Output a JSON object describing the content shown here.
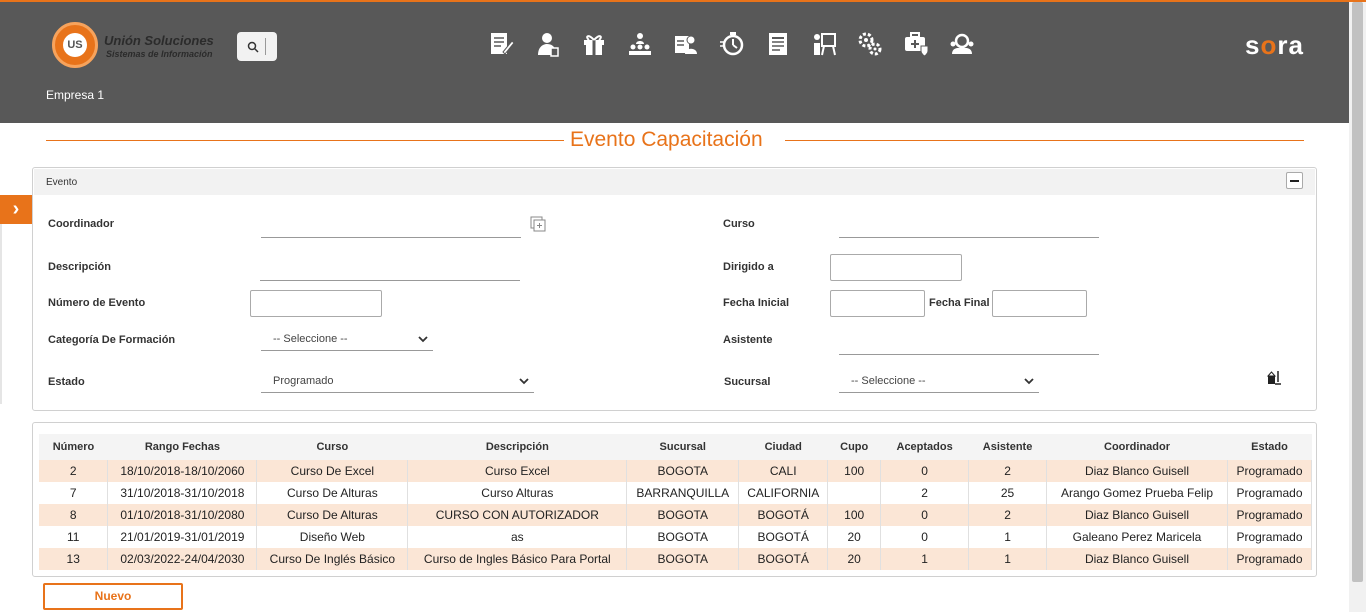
{
  "header": {
    "logo_name": "Unión Soluciones",
    "logo_sub": "Sistemas de Información",
    "logo_mark": "US",
    "brand_text": "sora",
    "company": "Empresa 1",
    "nav_icons": [
      "document-edit-icon",
      "user-touch-icon",
      "gift-icon",
      "team-hierarchy-icon",
      "user-card-icon",
      "stopwatch-icon",
      "report-list-icon",
      "presentation-icon",
      "gears-icon",
      "medical-case-icon",
      "group-search-icon"
    ]
  },
  "page_title": "Evento Capacitación",
  "form": {
    "section_title": "Evento",
    "coordinador_label": "Coordinador",
    "curso_label": "Curso",
    "descripcion_label": "Descripción",
    "dirigido_label": "Dirigido a",
    "numero_label": "Número de Evento",
    "fecha_inicial_label": "Fecha Inicial",
    "fecha_final_label": "Fecha Final",
    "categoria_label": "Categoría De Formación",
    "categoria_value": "-- Seleccione --",
    "asistente_label": "Asistente",
    "estado_label": "Estado",
    "estado_value": "Programado",
    "sucursal_label": "Sucursal",
    "sucursal_value": "-- Seleccione --"
  },
  "table": {
    "headers": [
      "Número",
      "Rango Fechas",
      "Curso",
      "Descripción",
      "Sucursal",
      "Ciudad",
      "Cupo",
      "Aceptados",
      "Asistente",
      "Coordinador",
      "Estado"
    ],
    "rows": [
      [
        "2",
        "18/10/2018-18/10/2060",
        "Curso De Excel",
        "Curso Excel",
        "BOGOTA",
        "CALI",
        "100",
        "0",
        "2",
        "Diaz Blanco Guisell",
        "Programado"
      ],
      [
        "7",
        "31/10/2018-31/10/2018",
        "Curso De Alturas",
        "Curso Alturas",
        "BARRANQUILLA",
        "CALIFORNIA",
        "",
        "2",
        "25",
        "Arango Gomez Prueba Felip",
        "Programado"
      ],
      [
        "8",
        "01/10/2018-31/10/2080",
        "Curso De Alturas",
        "CURSO CON AUTORIZADOR",
        "BOGOTA",
        "BOGOTÁ",
        "100",
        "0",
        "2",
        "Diaz Blanco Guisell",
        "Programado"
      ],
      [
        "11",
        "21/01/2019-31/01/2019",
        "Diseño Web",
        "as",
        "BOGOTA",
        "BOGOTÁ",
        "20",
        "0",
        "1",
        "Galeano Perez Maricela",
        "Programado"
      ],
      [
        "13",
        "02/03/2022-24/04/2030",
        "Curso De Inglés Básico",
        "Curso de Ingles Básico Para Portal",
        "BOGOTA",
        "BOGOTÁ",
        "20",
        "1",
        "1",
        "Diaz Blanco Guisell",
        "Programado"
      ]
    ]
  },
  "buttons": {
    "nuevo": "Nuevo"
  },
  "colors": {
    "accent": "#e8731a",
    "header_bg": "#585858",
    "row_highlight": "#fbe6d6"
  }
}
